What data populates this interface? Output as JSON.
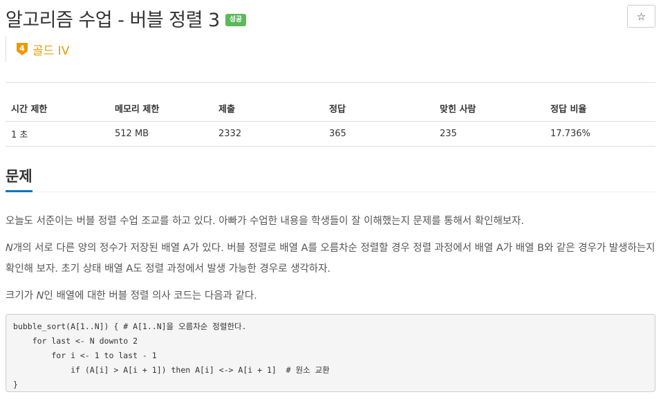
{
  "problem": {
    "title": "알고리즘 수업 - 버블 정렬 3",
    "result_badge": "성공",
    "star_icon": "☆",
    "tier": {
      "level": "4",
      "label": "골드 IV",
      "color": "#ec9a00"
    }
  },
  "stats": {
    "headers": [
      "시간 제한",
      "메모리 제한",
      "제출",
      "정답",
      "맞힌 사람",
      "정답 비율"
    ],
    "values": [
      "1 초",
      "512 MB",
      "2332",
      "365",
      "235",
      "17.736%"
    ]
  },
  "section": {
    "title": "문제"
  },
  "description": {
    "p1": "오늘도 서준이는 버블 정렬 수업 조교를 하고 있다. 아빠가 수업한 내용을 학생들이 잘 이해했는지 문제를 통해서 확인해보자.",
    "p2_var": "N",
    "p2_rest": "개의 서로 다른 양의 정수가 저장된 배열 A가 있다. 버블 정렬로 배열 A를 오름차순 정렬할 경우 정렬 과정에서 배열 A가 배열 B와 같은 경우가 발생하는지 확인해 보자. 초기 상태 배열 A도 정렬 과정에서 발생 가능한 경우로 생각하자.",
    "p3_pre": "크기가 ",
    "p3_var": "N",
    "p3_post": "인 배열에 대한 버블 정렬 의사 코드는 다음과 같다."
  },
  "code": {
    "text": "bubble_sort(A[1..N]) { # A[1..N]을 오름차순 정렬한다.\n    for last <- N downto 2\n        for i <- 1 to last - 1\n            if (A[i] > A[i + 1]) then A[i] <-> A[i + 1]  # 원소 교환\n}"
  },
  "colors": {
    "badge_success": "#5cb85c",
    "section_underline": "#0076c0",
    "tier_gold": "#ec9a00"
  }
}
